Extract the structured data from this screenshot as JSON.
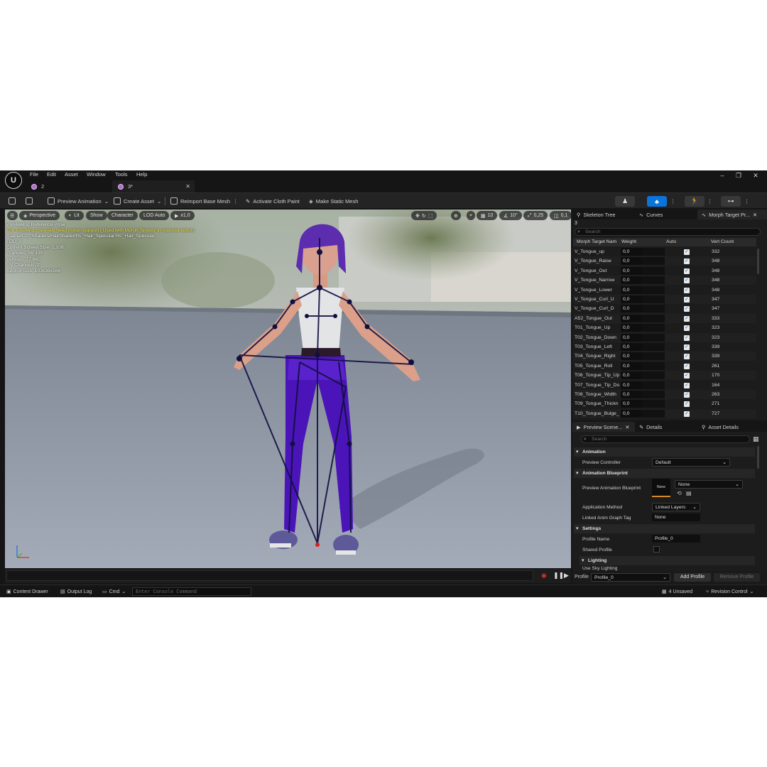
{
  "menu": [
    "File",
    "Edit",
    "Asset",
    "Window",
    "Tools",
    "Help"
  ],
  "doc_tabs": [
    {
      "label": "2",
      "active": false
    },
    {
      "label": "3*",
      "active": true
    }
  ],
  "toolbar": {
    "preview_animation": "Preview Animation",
    "create_asset": "Create Asset",
    "reimport": "Reimport Base Mesh",
    "cloth_paint": "Activate Cloth Paint",
    "static_mesh": "Make Static Mesh"
  },
  "viewport": {
    "perspective": "Perspective",
    "lit": "Lit",
    "show": "Show",
    "character": "Character",
    "lod": "LOD Auto",
    "speed": "x1,0",
    "grid": "10",
    "angle": "10°",
    "scale": "0,25",
    "cam": "0,1",
    "info": {
      "line1": "Previewing Reference Pose",
      "warn": "The following materials need morph support ('Used with Morph Targets' in material editor):",
      "path": "/Game/CC_Shaders/HairShader/RL_Hair_Specular:RL_Hair_Specular",
      "lod": "LOD: 0",
      "screen": "Current Screen Size: 1,108",
      "tris": "Triangles: 98 135",
      "verts": "Vertices: 77 660",
      "uv": "UV Channels: 2",
      "size": "Approx Size: 103x36x166"
    }
  },
  "morph_panel": {
    "tabs": [
      "Skeleton Tree",
      "Curves",
      "Morph Target Pr..."
    ],
    "count": "3",
    "search_placeholder": "Search",
    "headers": {
      "name": "Morph Target Nam",
      "weight": "Weight",
      "auto": "Auto",
      "vert": "Vert Count"
    },
    "rows": [
      {
        "name": "V_Tongue_up",
        "weight": "0,0",
        "vert": "332"
      },
      {
        "name": "V_Tongue_Raise",
        "weight": "0,0",
        "vert": "348"
      },
      {
        "name": "V_Tongue_Out",
        "weight": "0,0",
        "vert": "348"
      },
      {
        "name": "V_Tongue_Narrow",
        "weight": "0,0",
        "vert": "348"
      },
      {
        "name": "V_Tongue_Lower",
        "weight": "0,0",
        "vert": "348"
      },
      {
        "name": "V_Tongue_Curl_U",
        "weight": "0,0",
        "vert": "347"
      },
      {
        "name": "V_Tongue_Curl_D",
        "weight": "0,0",
        "vert": "347"
      },
      {
        "name": "A52_Tongue_Out",
        "weight": "0,0",
        "vert": "333"
      },
      {
        "name": "T01_Tongue_Up",
        "weight": "0,0",
        "vert": "323"
      },
      {
        "name": "T02_Tongue_Down",
        "weight": "0,0",
        "vert": "323"
      },
      {
        "name": "T03_Tongue_Left",
        "weight": "0,0",
        "vert": "339"
      },
      {
        "name": "T04_Tongue_Right",
        "weight": "0,0",
        "vert": "339"
      },
      {
        "name": "T05_Tongue_Roll",
        "weight": "0,0",
        "vert": "261"
      },
      {
        "name": "T06_Tongue_Tip_Up",
        "weight": "0,0",
        "vert": "170"
      },
      {
        "name": "T07_Tongue_Tip_Do",
        "weight": "0,0",
        "vert": "164"
      },
      {
        "name": "T08_Tongue_Width",
        "weight": "0,0",
        "vert": "263"
      },
      {
        "name": "T09_Tongue_Thickn",
        "weight": "0,0",
        "vert": "271"
      },
      {
        "name": "T10_Tongue_Bulge_",
        "weight": "0,0",
        "vert": "727"
      }
    ]
  },
  "details_panel": {
    "tabs": [
      "Preview Scene...",
      "Details",
      "Asset Details"
    ],
    "search_placeholder": "Search",
    "sections": {
      "animation": "Animation",
      "anim_bp": "Animation Blueprint",
      "settings": "Settings",
      "lighting": "Lighting"
    },
    "props": {
      "preview_controller": "Preview Controller",
      "preview_controller_val": "Default",
      "preview_anim_bp": "Preview Animation Blueprint",
      "anim_bp_thumb": "None",
      "anim_bp_val": "None",
      "app_method": "Application Method",
      "app_method_val": "Linked Layers",
      "linked_tag": "Linked Anim Graph Tag",
      "linked_tag_val": "None",
      "profile_name": "Profile Name",
      "profile_name_val": "Profile_0",
      "shared_profile": "Shared Profile",
      "use_sky": "Use Sky Lighting"
    },
    "footer": {
      "profile_label": "Profile",
      "profile_val": "Profile_0",
      "add": "Add Profile",
      "remove": "Remove Profile"
    }
  },
  "status": {
    "content_drawer": "Content Drawer",
    "output_log": "Output Log",
    "cmd": "Cmd",
    "console_placeholder": "Enter Console Command",
    "unsaved": "4 Unsaved",
    "revision": "Revision Control"
  }
}
